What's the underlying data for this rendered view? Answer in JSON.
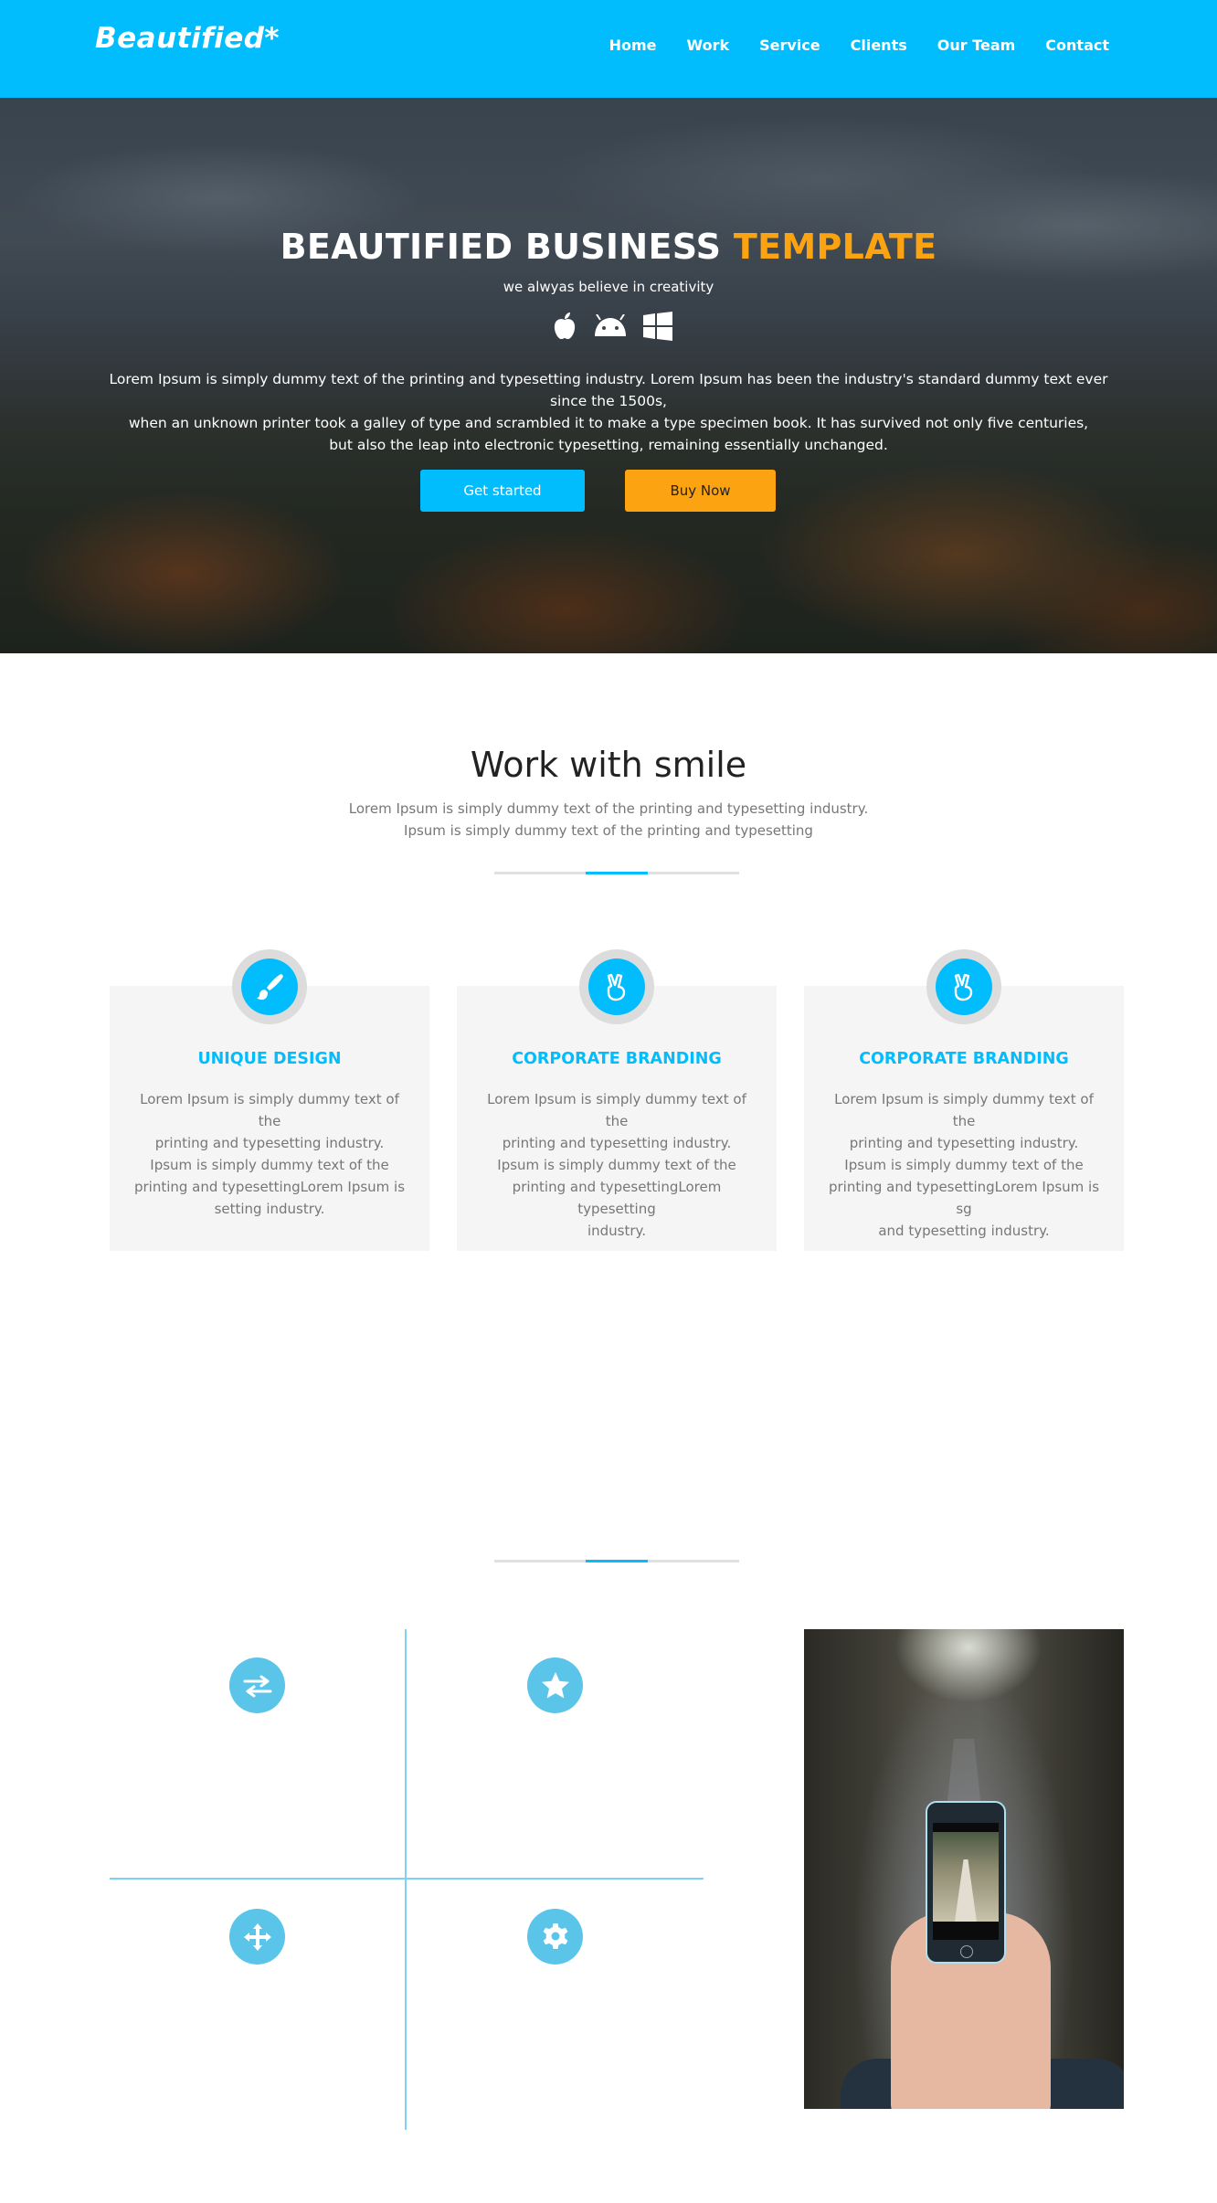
{
  "header": {
    "brand": "Beautified*",
    "nav": [
      "Home",
      "Work",
      "Service",
      "Clients",
      "Our Team",
      "Contact"
    ]
  },
  "hero": {
    "title_main": "BEAUTIFIED BUSINESS",
    "title_accent": "TEMPLATE",
    "subtitle": "we alwyas believe in creativity",
    "platform_icons": [
      "apple-icon",
      "android-icon",
      "windows-icon"
    ],
    "text_lines": [
      "Lorem Ipsum is simply dummy text of the printing and typesetting industry. Lorem Ipsum has been the industry's standard dummy text ever since the 1500s,",
      "when an unknown printer took a galley of type and scrambled it to make a type specimen book. It has survived not only five centuries,",
      "but also the leap into electronic typesetting, remaining essentially unchanged."
    ],
    "btn_primary": "Get started",
    "btn_buy": "Buy Now"
  },
  "work": {
    "title": "Work with smile",
    "subtitle_lines": [
      "Lorem Ipsum is simply dummy text of the printing and typesetting industry.",
      "Ipsum is simply dummy text of the printing and typesetting"
    ],
    "cards": [
      {
        "icon": "brush-icon",
        "title": "UNIQUE DESIGN",
        "text_lines": [
          "Lorem Ipsum is simply dummy text of the",
          "printing and typesetting industry.",
          "Ipsum is simply dummy text of the",
          "printing and typesettingLorem Ipsum is",
          "setting industry."
        ]
      },
      {
        "icon": "peace-hand-icon",
        "title": "CORPORATE BRANDING",
        "text_lines": [
          "Lorem Ipsum is simply dummy text of the",
          "printing and typesetting industry.",
          "Ipsum is simply dummy text of the",
          "printing and typesettingLorem typesetting",
          "industry."
        ]
      },
      {
        "icon": "peace-hand-icon",
        "title": "CORPORATE BRANDING",
        "text_lines": [
          "Lorem Ipsum is simply dummy text of the",
          "printing and typesetting industry.",
          "Ipsum is simply dummy text of the",
          "printing and typesettingLorem Ipsum is sg",
          "and typesetting industry."
        ]
      }
    ]
  },
  "features": {
    "icons": [
      "exchange-arrows-icon",
      "star-icon",
      "move-arrows-icon",
      "gear-icon"
    ]
  },
  "colors": {
    "brand_blue": "#01bdfd",
    "accent_orange": "#fba311",
    "feature_icon_blue": "#5ac5e8"
  }
}
